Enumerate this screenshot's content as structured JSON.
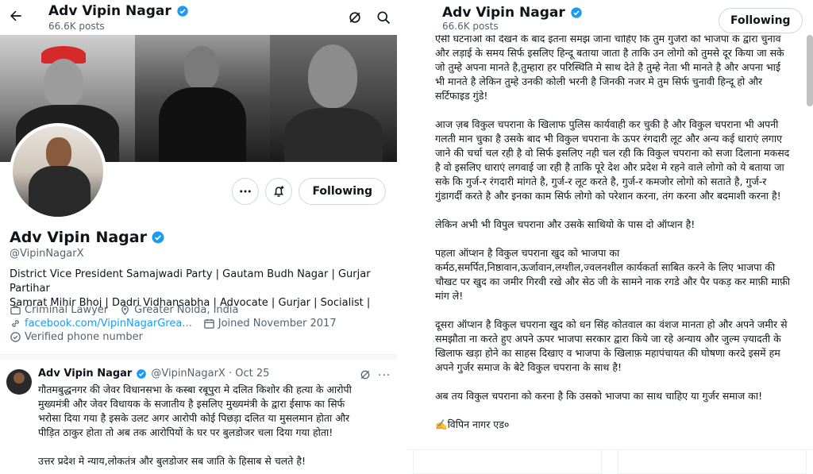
{
  "left": {
    "header": {
      "name": "Adv Vipin Nagar",
      "posts": "66.6K posts"
    },
    "profile": {
      "name": "Adv Vipin Nagar",
      "handle": "@VipinNagarX",
      "follow_label": "Following",
      "bio_line1": "District Vice President Samajwadi Party | Gautam Budh Nagar | Gurjar Partihar",
      "bio_line2": "Samrat Mihir Bhoj | Dadri Vidhansabha | Advocate | Gurjar | Socialist |",
      "category": "Criminal Lawyer",
      "location": "Greater Noida, India",
      "website": "facebook.com/VipinNagarGrea...",
      "joined": "Joined November 2017",
      "verified_text": "Verified phone number"
    },
    "tweet": {
      "name": "Adv Vipin Nagar",
      "handle_date": "@VipinNagarX · Oct 25",
      "more": "···",
      "lines": [
        "गौतमबुद्धनगर की जेवर विधानसभा के कस्बा रबूपुरा मे दलित किशोर की हत्या के आरोपी",
        "मुख्यमंत्री और जेवर विधायक के सजातीय है इसलिए मुख्यमंत्री के द्वारा ईसाफ का सिर्फ",
        "भरोसा दिया गया है इसके उलट अगर आरोपी कोई पिछड़ा दलित या मुसलमान होता और",
        "पीड़ित ठाकुर होता तो अब तक आरोपियों के घर पर बुलडोजर चला दिया गया होता!"
      ],
      "line5": "उत्तर प्रदेश मे न्याय,लोकतंत्र और बुलडोजर सब जाति के हिसाब से चलते है!"
    }
  },
  "right": {
    "header": {
      "name": "Adv Vipin Nagar",
      "posts": "66.6K posts",
      "follow_label": "Following"
    },
    "paragraphs": [
      "ऐसी घटनाओ को देखने के बाद इतना समझ जाना चाहिए कि तुम गुर्जरों को भाजपा के द्वारा चुनाव और लड़ाई के समय सिर्फ इसलिए हिन्दू बताया जाता है ताकि उन लोगो को तुमसे दूर किया जा सके जो तुम्हे अपना मानते है,तुम्हारा हर परिस्थिति मे साथ देते है तुम्हे नेता भी मानते है और अपना भाई भी मानते है लेकिन तुम्हे उनकी कोली भरनी है जिनकी नजर मे तुम सिर्फ चुनावी हिन्दू हो और सर्टिफाइड गुंडे!",
      "आज ज़ब विकुल चपराना के खिलाफ पुलिस कार्यवाही कर चुकी है और विकुल चपराना भी अपनी गलती मान चुका है उसके बाद भी विकुल चपराना के ऊपर रंगदारी लूट और अन्य कई धाराएं लगाए जाने की चर्चा चल रही है वो सिर्फ इसलिए नही चल रही कि विकुल चपराना को सजा दिलाना मकसद है वो इसलिए धाराएं लगवाई जा रही है ताकि पूरे देश और प्रदेश मे रहने वाले लोगो को ये बताया जा सके कि गुर्ज-र रंगदारी मांगते है, गुर्ज-र लूट करते है, गुर्ज-र कमजोर लोगो को सताते है, गुर्ज-र गुंडागर्दी करते है और इनका काम सिर्फ लोगो को परेशान करना, तंग करना और बदमाशी करना है!",
      "लेकिन अभी भी विपुल चपराना और उसके साथियो के पास दो ऑप्शन है!",
      "पहला ऑप्शन है विकुल चपराना खुद को भाजपा का कर्मठ,समर्पित,निष्ठावान,ऊर्जावान,लग्शील,ज्वलनशील कार्यकर्ता साबित करने के लिए भाजपा की चौखट पर खुद का जमीर गिरवी रखे और सेठ जी के सामने नाक रगडे और पैर पकड़ कर माफ़ी माफ़ी मांग ले!",
      "दूसरा ऑप्शन है विकुल चपराना खुद को धन सिंह कोतवाल का वंशज मानता हो और अपने जमीर से समझौता ना करते हुए अपने ऊपर भाजपा सरकार द्वारा किये जा रहे अन्याय और जुल्म ज़्यादती के खिलाफ खड़ा होने का साहस दिखाए व भाजपा के खिलाफ़ महापंचायत की घोषणा करदे इसमें हम अपने गुर्जर समाज के बेटे विकुल चपराना के साथ है!",
      "अब तय विकुल चपराना को करना है कि उसको भाजपा का साथ चाहिए या गुर्जर समाज का!",
      "✍️विपिन नागर एड०"
    ]
  },
  "colors": {
    "accent": "#1d9bf0",
    "muted": "#536471",
    "text": "#0f1419",
    "border": "#cfd9de"
  }
}
